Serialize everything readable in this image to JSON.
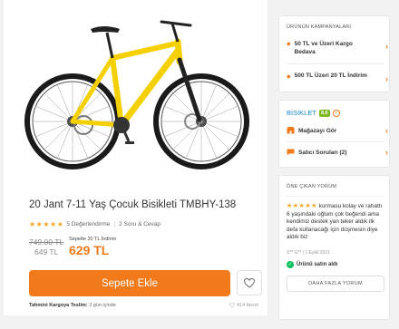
{
  "product": {
    "title": "20 Jant 7-11 Yaş Çocuk Bisikleti TMBHY-138",
    "rating_stars": "★★★★★",
    "reviews": "5 Değerlendirme",
    "qa": "2 Soru & Cevap",
    "old_price": "749.00 TL",
    "price": "649 TL",
    "cart_label": "Sepette 20 TL İndirim",
    "cart_price": "629 TL",
    "add_to_cart": "Sepete Ekle",
    "shipping_label": "Tahmini Kargoya Teslim:",
    "shipping_value": "2 gün içinde",
    "fav_count": "414 favori"
  },
  "campaigns": {
    "header": "ÜRÜNÜN KAMPANYALARI",
    "items": [
      {
        "label": "50 TL ve Üzeri Kargo Bedava"
      },
      {
        "label": "500 TL Üzeri 20 TL İndirim"
      }
    ]
  },
  "store": {
    "name": "BİSİKLET",
    "score": "8.6",
    "items": [
      {
        "label": "Mağazayı Gör"
      },
      {
        "label": "Satıcı Soruları (2)"
      }
    ]
  },
  "featured_review": {
    "header": "ÖNE ÇIKAN YORUM",
    "stars": "★★★★★",
    "text": "kurmasu kolay ve rahattı 6 yaşındaki oğlum çok beğendi ama kendimiz destek yan teker aldık ilk defa kullanacağı için düşmesin diye aldık biz",
    "meta": "S** G** | 1 Eylül 2021",
    "verified": "Ürünü satın aldı",
    "more": "DAHA FAZLA YORUM"
  },
  "colors": {
    "accent": "#f27a1a",
    "bike": "#f5d000",
    "link": "#1a88c9",
    "score": "#7ab81e",
    "verified": "#0bc15c"
  }
}
